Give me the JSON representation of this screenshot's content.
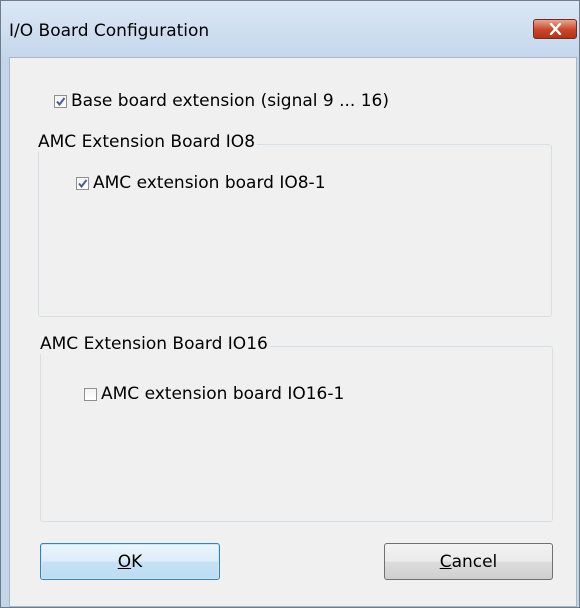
{
  "window": {
    "title": "I/O Board Configuration"
  },
  "base_extension": {
    "label": "Base board extension (signal  9  ... 16)",
    "checked": true
  },
  "group_io8": {
    "caption": "AMC Extension Board IO8",
    "checkbox": {
      "label": "AMC extension board  IO8-1",
      "checked": true
    }
  },
  "group_io16": {
    "caption": "AMC Extension Board IO16",
    "checkbox": {
      "label": "AMC extension board  IO16-1",
      "checked": false
    }
  },
  "buttons": {
    "ok": {
      "mnemonic": "O",
      "rest": "K"
    },
    "cancel": {
      "mnemonic": "C",
      "rest": "ancel"
    }
  },
  "colors": {
    "dialog_bg": "#f0f0f0",
    "frame": "#c4d5e8",
    "close_button": "#c8452b",
    "checkmark": "#4a5f97"
  }
}
